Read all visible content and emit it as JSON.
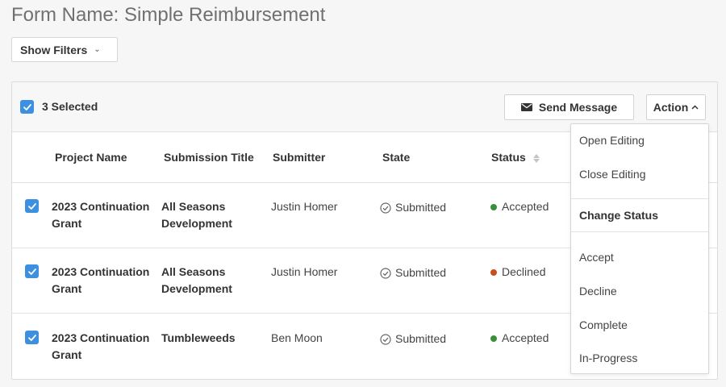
{
  "page": {
    "title": "Form Name: Simple Reimbursement"
  },
  "filters": {
    "label": "Show Filters"
  },
  "toolbar": {
    "selected_label": "3 Selected",
    "send_message_label": "Send Message",
    "action_label": "Action"
  },
  "table": {
    "columns": [
      "Project Name",
      "Submission Title",
      "Submitter",
      "State",
      "Status"
    ],
    "rows": [
      {
        "selected": true,
        "project_line1": "2023 Continuation",
        "project_line2": "Grant",
        "title_line1": "All Seasons",
        "title_line2": "Development",
        "submitter": "Justin Homer",
        "state": "Submitted",
        "status": "Accepted",
        "status_color": "#3a8f3a"
      },
      {
        "selected": true,
        "project_line1": "2023 Continuation",
        "project_line2": "Grant",
        "title_line1": "All Seasons",
        "title_line2": "Development",
        "submitter": "Justin Homer",
        "state": "Submitted",
        "status": "Declined",
        "status_color": "#c8501e"
      },
      {
        "selected": true,
        "project_line1": "2023 Continuation",
        "project_line2": "Grant",
        "title_line1": "Tumbleweeds",
        "title_line2": "",
        "submitter": "Ben Moon",
        "state": "Submitted",
        "status": "Accepted",
        "status_color": "#3a8f3a"
      }
    ]
  },
  "action_menu": {
    "items_top": [
      "Open Editing",
      "Close Editing"
    ],
    "heading": "Change Status",
    "items_status": [
      "Accept",
      "Decline",
      "Complete",
      "In-Progress"
    ]
  },
  "colors": {
    "checkbox": "#3d8fe0",
    "accepted": "#3a8f3a",
    "declined": "#c8501e"
  }
}
